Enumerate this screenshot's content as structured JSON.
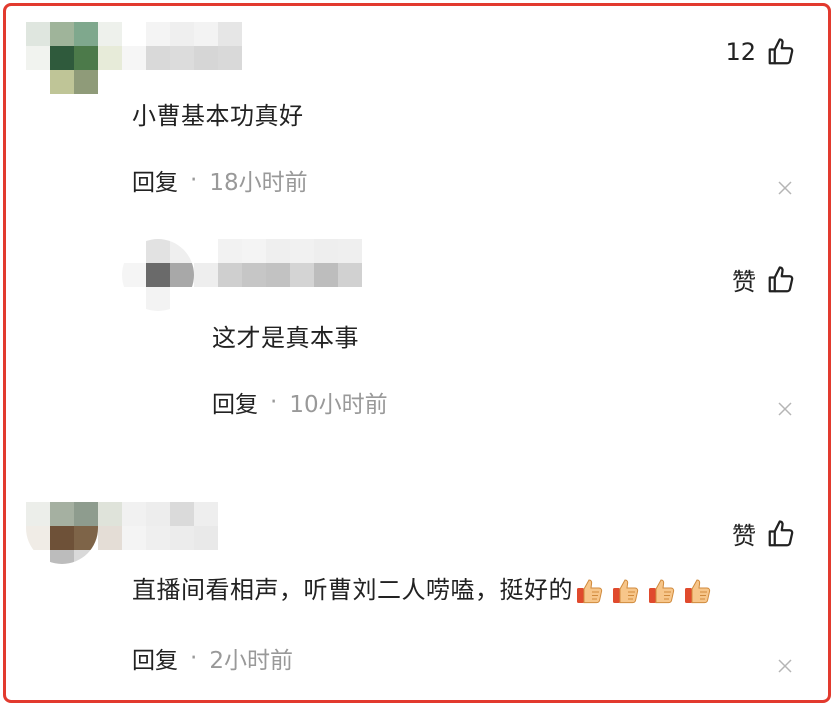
{
  "comments": [
    {
      "likes": "12",
      "text": "小曹基本功真好",
      "reply_label": "回复",
      "separator": "·",
      "time": "18小时前"
    },
    {
      "likes": "赞",
      "text": "这才是真本事",
      "reply_label": "回复",
      "separator": "·",
      "time": "10小时前"
    },
    {
      "likes": "赞",
      "text": "直播间看相声，听曹刘二人唠嗑，挺好的",
      "reply_label": "回复",
      "separator": "·",
      "time": "2小时前"
    }
  ],
  "colors": {
    "frame": "#e23a2e",
    "muted": "#999999",
    "text": "#222222"
  },
  "icons": {
    "like": "thumbs-up-outline-icon",
    "close": "close-x-icon",
    "emoji": "thumbs-up-emoji-icon"
  }
}
